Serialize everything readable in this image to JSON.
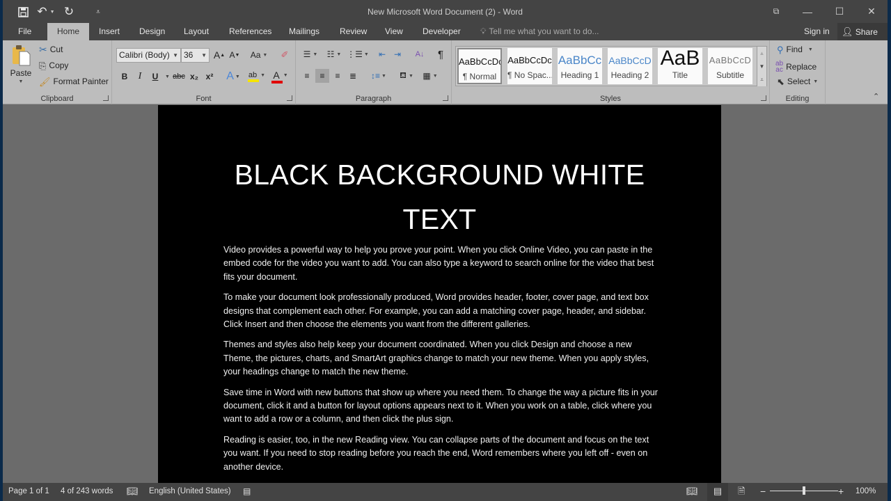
{
  "window": {
    "title": "New Microsoft Word Document (2) - Word",
    "quick_access": [
      {
        "name": "save-icon",
        "glyph": "🖫"
      },
      {
        "name": "undo-icon",
        "glyph": "↶"
      },
      {
        "name": "redo-icon",
        "glyph": "↻"
      },
      {
        "name": "customize-qat-icon",
        "glyph": "⩡"
      }
    ],
    "controls": {
      "ribbon_display": "⧉",
      "minimize": "—",
      "maximize": "☐",
      "close": "✕"
    }
  },
  "tabs": {
    "items": [
      "File",
      "Home",
      "Insert",
      "Design",
      "Layout",
      "References",
      "Mailings",
      "Review",
      "View",
      "Developer"
    ],
    "active": "Home",
    "tell_me": "Tell me what you want to do...",
    "sign_in": "Sign in",
    "share": "Share"
  },
  "ribbon": {
    "clipboard": {
      "label": "Clipboard",
      "paste": "Paste",
      "cut": "Cut",
      "copy": "Copy",
      "format_painter": "Format Painter"
    },
    "font": {
      "label": "Font",
      "font_name": "Calibri (Body)",
      "font_size": "36",
      "grow": "A",
      "shrink": "A",
      "change_case": "Aa",
      "bold": "B",
      "italic": "I",
      "underline": "U",
      "strikethrough": "abc",
      "subscript": "x₂",
      "superscript": "x²",
      "text_effects": "A",
      "highlight": "ab",
      "font_color": "A",
      "highlight_color": "#f5e400",
      "font_color_value": "#e00000"
    },
    "paragraph": {
      "label": "Paragraph"
    },
    "styles": {
      "label": "Styles",
      "items": [
        {
          "preview": "AaBbCcDc",
          "name": "¶ Normal",
          "selected": true
        },
        {
          "preview": "AaBbCcDc",
          "name": "¶ No Spac...",
          "selected": false
        },
        {
          "preview": "AaBbCc",
          "name": "Heading 1",
          "selected": false
        },
        {
          "preview": "AaBbCcD",
          "name": "Heading 2",
          "selected": false
        },
        {
          "preview": "AaB",
          "name": "Title",
          "selected": false
        },
        {
          "preview": "AaBbCcD",
          "name": "Subtitle",
          "selected": false
        }
      ]
    },
    "editing": {
      "label": "Editing",
      "find": "Find",
      "replace": "Replace",
      "select": "Select"
    }
  },
  "document": {
    "heading_line1": "BLACK BACKGROUND WHITE",
    "heading_line2": "TEXT",
    "paragraphs": [
      "Video provides a powerful way to help you prove your point. When you click Online Video, you can paste in the embed code for the video you want to add. You can also type a keyword to search online for the video that best fits your document.",
      "To make your document look professionally produced, Word provides header, footer, cover page, and text box designs that complement each other. For example, you can add a matching cover page, header, and sidebar. Click Insert and then choose the elements you want from the different galleries.",
      "Themes and styles also help keep your document coordinated. When you click Design and choose a new Theme, the pictures, charts, and SmartArt graphics change to match your new theme. When you apply styles, your headings change to match the new theme.",
      "Save time in Word with new buttons that show up where you need them. To change the way a picture fits in your document, click it and a button for layout options appears next to it. When you work on a table, click where you want to add a row or a column, and then click the plus sign.",
      "Reading is easier, too, in the new Reading view. You can collapse parts of the document and focus on the text you want. If you need to stop reading before you reach the end, Word remembers where you left off - even on another device."
    ]
  },
  "status": {
    "page": "Page 1 of 1",
    "words": "4 of 243 words",
    "language": "English (United States)",
    "zoom": "100%",
    "zoom_fraction": 0.5
  }
}
